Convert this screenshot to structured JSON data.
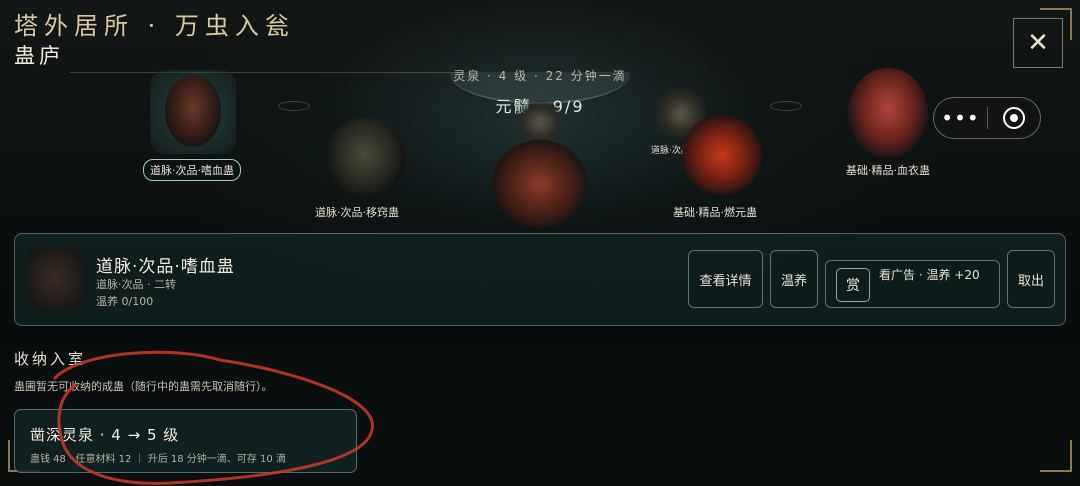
{
  "header": {
    "title": "塔外居所 · 万虫入瓮",
    "subtitle": "蛊庐"
  },
  "spring": {
    "info": "灵泉 · 4 级 · 22 分钟一滴",
    "essence": "元髓 · 9/9"
  },
  "creatures": [
    {
      "label": "道脉·次品·嗜血蛊",
      "selected": true
    },
    {
      "label": "道脉·次品·移窍蛊",
      "selected": false
    },
    {
      "label": "基础·精品·燃元蛊",
      "selected": false
    },
    {
      "label": "道脉·次品",
      "selected": false
    },
    {
      "label": "基础·精品·血衣蛊",
      "selected": false
    }
  ],
  "detail": {
    "name": "道脉·次品·嗜血蛊",
    "grade": "道脉·次品 · 二转",
    "nurture": "温养 0/100",
    "buttons": {
      "view": "查看详情",
      "nurture": "温养",
      "reward_badge": "赏",
      "ad": "看广告 · 温养 +20",
      "withdraw": "取出"
    }
  },
  "store": {
    "title": "收纳入室",
    "desc": "蛊圃暂无可收纳的成蛊（随行中的蛊需先取消随行）。",
    "upgrade_title": "凿深灵泉 · 4 → 5 级",
    "upgrade_detail": "蛊钱 48 · 任意材料 12 ｜ 升后 18 分钟一滴、可存 10 滴"
  },
  "icons": {
    "close": "close-icon",
    "more": "more-dots-icon",
    "capsule_close": "target-icon"
  },
  "colors": {
    "accent_frame": "#8b7a54",
    "panel_border": "#96beb9",
    "annotation": "#c0392b"
  }
}
